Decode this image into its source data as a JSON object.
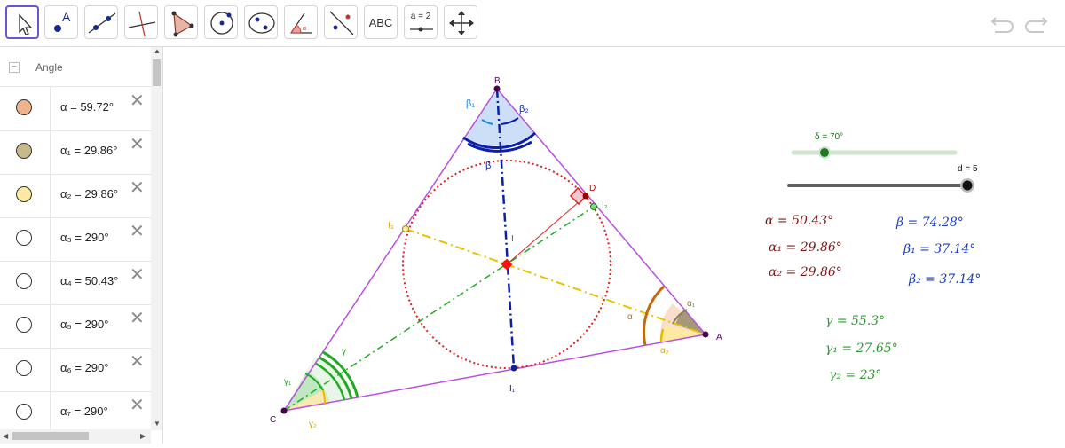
{
  "toolbar": {
    "tools": [
      {
        "name": "move-tool",
        "icon": "pointer-icon"
      },
      {
        "name": "point-tool",
        "icon": "point-icon",
        "label": "A"
      },
      {
        "name": "line-tool",
        "icon": "line-icon"
      },
      {
        "name": "perpendicular-tool",
        "icon": "perpendicular-icon"
      },
      {
        "name": "polygon-tool",
        "icon": "polygon-icon"
      },
      {
        "name": "circle-tool",
        "icon": "circle-icon"
      },
      {
        "name": "conic-tool",
        "icon": "ellipse-icon"
      },
      {
        "name": "angle-tool",
        "icon": "angle-icon"
      },
      {
        "name": "reflect-tool",
        "icon": "reflect-icon"
      },
      {
        "name": "text-tool",
        "icon": "text-icon",
        "label": "ABC"
      },
      {
        "name": "slider-tool",
        "icon": "slider-icon",
        "label": "a = 2"
      },
      {
        "name": "move-graphics-tool",
        "icon": "move-arrows-icon"
      }
    ],
    "undo_icon": "undo-icon",
    "redo_icon": "redo-icon"
  },
  "algebra": {
    "title": "Angle",
    "rows": [
      {
        "text": "α = 59.72°",
        "color": "#f0b48c"
      },
      {
        "text": "α₁ = 29.86°",
        "color": "#c8b98c"
      },
      {
        "text": "α₂ = 29.86°",
        "color": "#fde9a0"
      },
      {
        "text": "α₃ = 290°",
        "color": "#ffffff"
      },
      {
        "text": "α₄ = 50.43°",
        "color": "#ffffff"
      },
      {
        "text": "α₅ = 290°",
        "color": "#ffffff"
      },
      {
        "text": "α₆ = 290°",
        "color": "#ffffff"
      },
      {
        "text": "α₇ = 290°",
        "color": "#ffffff"
      }
    ]
  },
  "graphics": {
    "sliders": {
      "delta_label": "δ = 70°",
      "d_label": "d = 5"
    },
    "points": {
      "A": "A",
      "B": "B",
      "C": "C",
      "D": "D",
      "I": "I",
      "I1": "I₁",
      "I2": "I₂",
      "I3": "I₃"
    },
    "angle_labels": {
      "beta1": "β₁",
      "beta2": "β₂",
      "beta": "β",
      "alpha": "α",
      "alpha1": "α₁",
      "alpha2": "α₂",
      "gamma": "γ",
      "gamma1": "γ₁",
      "gamma2": "γ₂"
    },
    "texts": {
      "alpha": "α = 50.43°",
      "alpha1": "α₁ = 29.86°",
      "alpha2": "α₂ = 29.86°",
      "beta": "β = 74.28°",
      "beta1": "β₁ = 37.14°",
      "beta2": "β₂ = 37.14°",
      "gamma": "γ = 55.3°",
      "gamma1": "γ₁ = 27.65°",
      "gamma2": "γ₂ = 23°"
    },
    "colors": {
      "triangle": "#b84fe0",
      "alpha_text": "#7b1c1c",
      "beta_text": "#1a3fbf",
      "gamma_text": "#2e9a2e",
      "incircle": "#e02020",
      "bisector_b": "#0b1fa8",
      "bisector_a": "#e6c200",
      "bisector_c": "#22aa22",
      "accent": "#6557d2"
    }
  }
}
